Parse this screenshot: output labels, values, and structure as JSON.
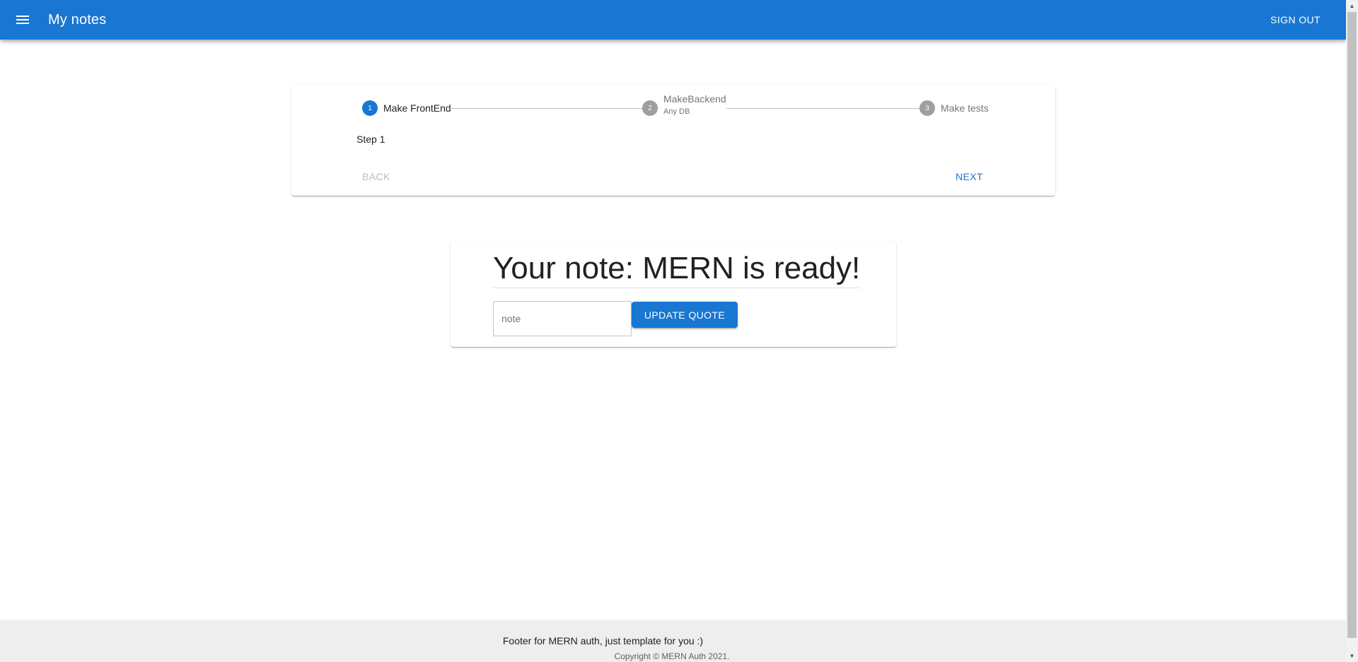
{
  "appbar": {
    "title": "My notes",
    "signout_label": "SIGN OUT"
  },
  "stepper": {
    "steps": [
      {
        "number": "1",
        "label": "Make FrontEnd",
        "sublabel": "",
        "active": true
      },
      {
        "number": "2",
        "label": "MakeBackend",
        "sublabel": "Any DB",
        "active": false
      },
      {
        "number": "3",
        "label": "Make tests",
        "sublabel": "",
        "active": false
      }
    ],
    "content": "Step 1",
    "back_label": "BACK",
    "next_label": "NEXT"
  },
  "note": {
    "heading": "Your note: MERN is ready!",
    "input_placeholder": "note",
    "input_value": "",
    "button_label": "UPDATE QUOTE"
  },
  "footer": {
    "text": "Footer for MERN auth, just template for you :)",
    "copyright": "Copyright © MERN Auth 2021."
  },
  "colors": {
    "primary": "#1976d2",
    "inactive": "#9e9e9e",
    "footer_bg": "#eeeeee"
  }
}
